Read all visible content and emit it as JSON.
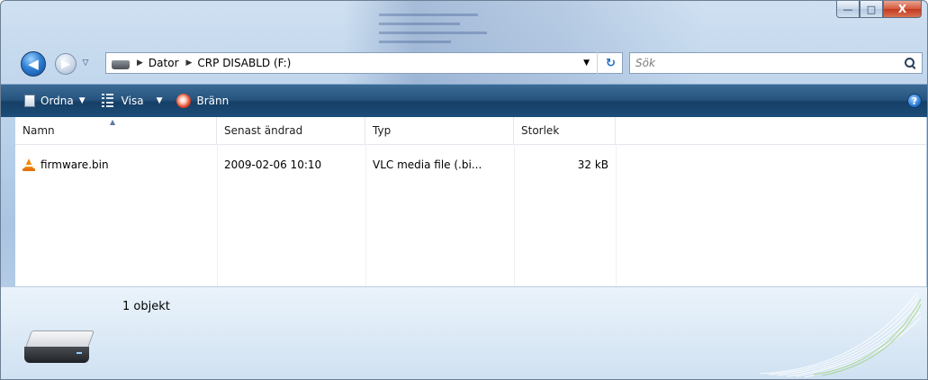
{
  "window": {
    "caption_buttons": {
      "minimize": "—",
      "maximize": "□",
      "close": "X"
    }
  },
  "nav": {
    "back_glyph": "◀",
    "forward_glyph": "▶",
    "history_glyph": "▽",
    "breadcrumb_sep": "▶",
    "breadcrumbs": [
      "Dator",
      "CRP DISABLD (F:)"
    ],
    "address_dropdown_glyph": "▼",
    "refresh_glyph": "↻"
  },
  "search": {
    "placeholder": "Sök"
  },
  "toolbar": {
    "ordna_label": "Ordna",
    "visa_label": "Visa",
    "brann_label": "Bränn",
    "caret": "▼",
    "help_glyph": "?"
  },
  "columns": {
    "name": "Namn",
    "modified": "Senast ändrad",
    "type": "Typ",
    "size": "Storlek",
    "sort_glyph": "▲"
  },
  "files": [
    {
      "name": "firmware.bin",
      "modified": "2009-02-06 10:10",
      "type": "VLC media file (.bi...",
      "size": "32 kB"
    }
  ],
  "details": {
    "count": "1 objekt"
  },
  "icons": {
    "drive": "drive-icon",
    "file": "vlc-cone-icon",
    "search": "search-icon",
    "help": "help-icon",
    "burn": "burn-icon"
  },
  "colors": {
    "toolbar": "#1c4d79",
    "accent": "#2c7ad4"
  }
}
